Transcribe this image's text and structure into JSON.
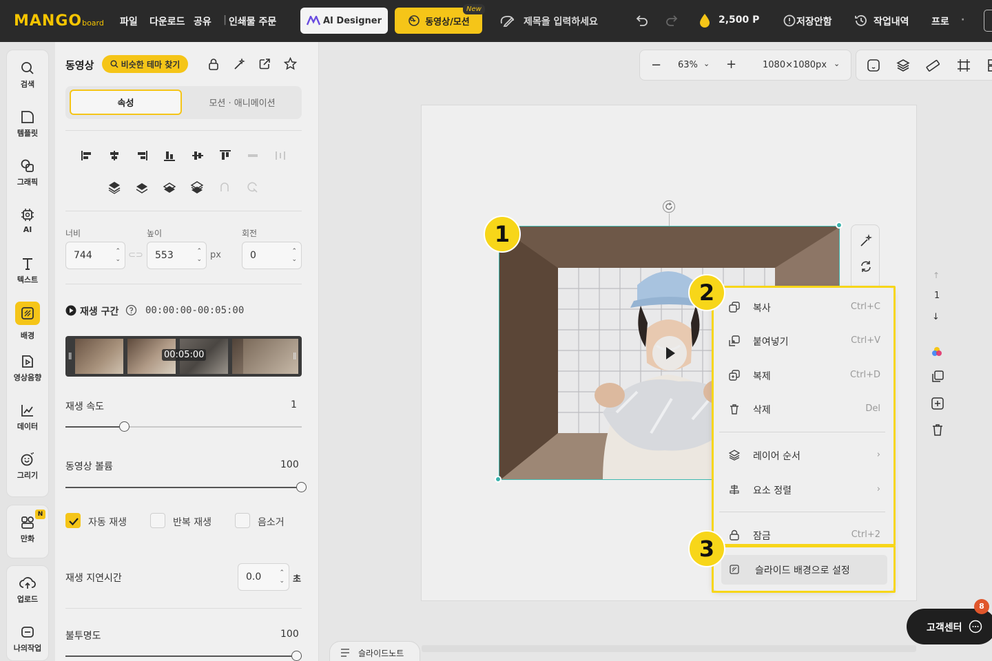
{
  "topbar": {
    "logo_main": "MANGO",
    "logo_sub": "board",
    "menu": [
      "파일",
      "다운로드",
      "공유",
      "인쇄물 주문"
    ],
    "ai_designer": "AI Designer",
    "video_motion": "동영상/모션",
    "new_badge": "New",
    "title_placeholder": "제목을 입력하세요",
    "points": "2,500 P",
    "unsaved": "저장안함",
    "history": "작업내역",
    "pro": "프로"
  },
  "leftnav": {
    "items": [
      "검색",
      "템플릿",
      "그래픽",
      "AI",
      "텍스트",
      "배경",
      "영상음향",
      "데이터",
      "그리기"
    ],
    "comic": "만화",
    "comic_badge": "N",
    "upload": "업로드",
    "mywork": "나의작업"
  },
  "panel": {
    "title": "동영상",
    "theme_button": "비슷한 테마 찾기",
    "tab_properties": "속성",
    "tab_motion": "모션 · 애니메이션",
    "width_label": "너비",
    "height_label": "높이",
    "rotation_label": "회전",
    "width": "744",
    "height": "553",
    "unit": "px",
    "rotation": "0",
    "play_range_label": "재생 구간",
    "play_range": "00:00:00-00:05:00",
    "clip_duration": "00:05:00",
    "speed_label": "재생 속도",
    "speed_value": "1",
    "speed_fraction": 0.25,
    "volume_label": "동영상 볼륨",
    "volume_value": "100",
    "volume_fraction": 1.0,
    "autoplay": "자동 재생",
    "loop": "반복 재생",
    "mute": "음소거",
    "delay_label": "재생 지연시간",
    "delay_value": "0.0",
    "delay_unit": "초",
    "opacity_label": "불투명도",
    "opacity_value": "100"
  },
  "canvas": {
    "zoom": "63%",
    "size": "1080×1080px",
    "page_number": "1",
    "slide_note": "슬라이드노트"
  },
  "context_menu": {
    "items": [
      {
        "label": "복사",
        "shortcut": "Ctrl+C"
      },
      {
        "label": "붙여넣기",
        "shortcut": "Ctrl+V"
      },
      {
        "label": "복제",
        "shortcut": "Ctrl+D"
      },
      {
        "label": "삭제",
        "shortcut": "Del"
      },
      {
        "label": "레이어 순서",
        "shortcut": "›"
      },
      {
        "label": "요소 정렬",
        "shortcut": "›"
      },
      {
        "label": "잠금",
        "shortcut": "Ctrl+2"
      },
      {
        "label": "슬라이드 배경으로 설정",
        "shortcut": ""
      }
    ]
  },
  "markers": [
    "1",
    "2",
    "3"
  ],
  "support": {
    "label": "고객센터",
    "badge": "8"
  },
  "colors": {
    "accent": "#f5c518",
    "topbar": "#2a2a2a",
    "selection": "#3ab3ad",
    "highlight": "#f7d619"
  }
}
